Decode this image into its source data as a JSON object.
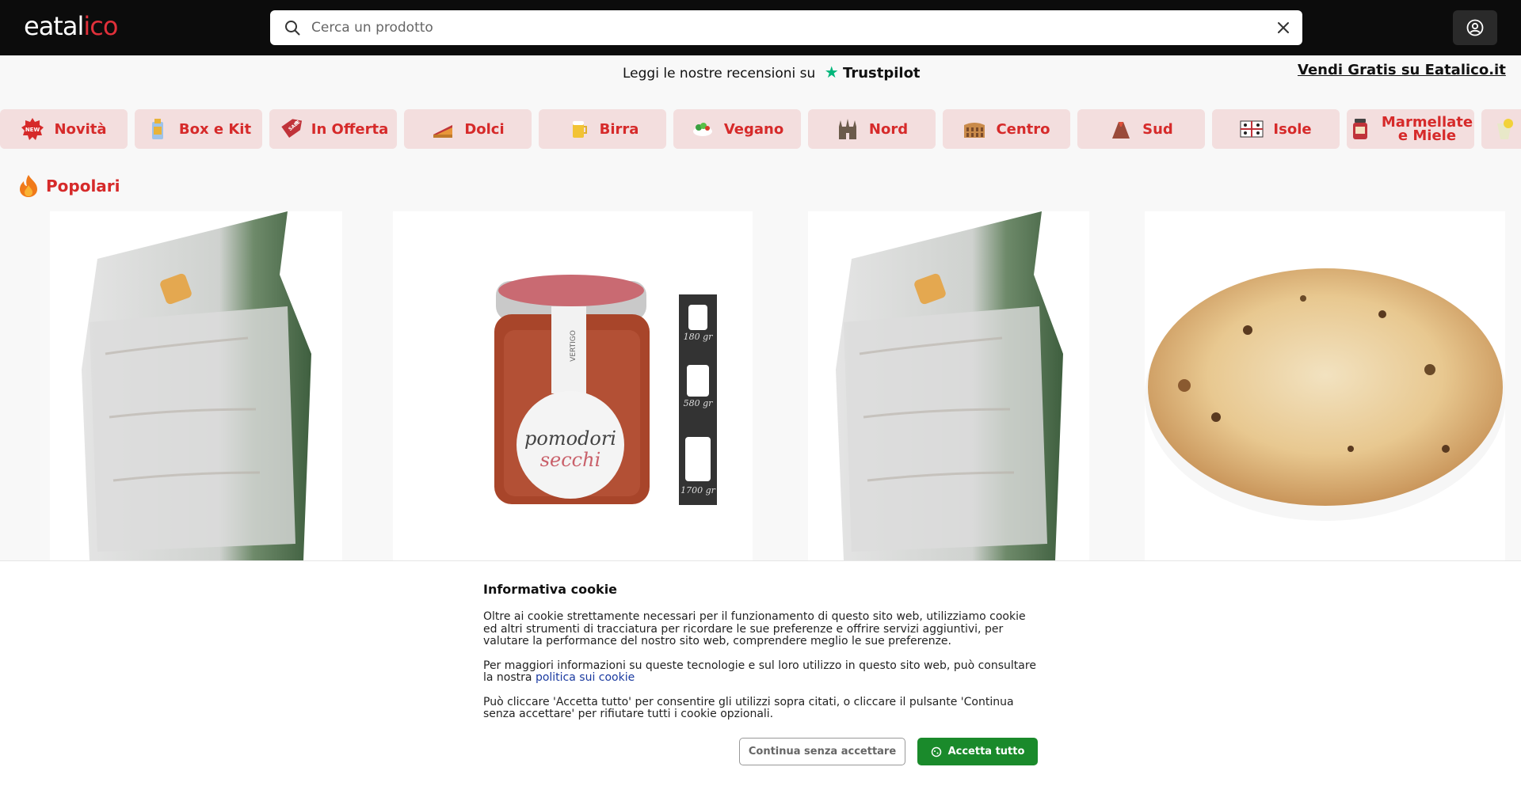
{
  "header": {
    "logo_left": "eatal",
    "logo_mid": "i",
    "logo_right": "co",
    "search_placeholder": "Cerca un prodotto"
  },
  "review": {
    "text": "Leggi le nostre recensioni su",
    "star": "★",
    "brand": "Trustpilot",
    "sell_link": "Vendi Gratis su Eatalico.it"
  },
  "categories": [
    {
      "label": "Novità",
      "icon": "new-badge-icon"
    },
    {
      "label": "Box e Kit",
      "icon": "box-icon"
    },
    {
      "label": "In Offerta",
      "icon": "sale-tag-icon"
    },
    {
      "label": "Dolci",
      "icon": "cake-icon"
    },
    {
      "label": "Birra",
      "icon": "beer-icon"
    },
    {
      "label": "Vegano",
      "icon": "salad-icon"
    },
    {
      "label": "Nord",
      "icon": "cathedral-icon"
    },
    {
      "label": "Centro",
      "icon": "colosseum-icon"
    },
    {
      "label": "Sud",
      "icon": "volcano-icon"
    },
    {
      "label": "Isole",
      "icon": "sardinia-flag-icon"
    },
    {
      "label_line1": "Marmellate",
      "label_line2": "e Miele",
      "icon": "jam-jar-icon"
    }
  ],
  "section": {
    "title": "Popolari"
  },
  "products": [
    {
      "image": "mushroom-grow-bag"
    },
    {
      "image": "sun-dried-tomato-jar",
      "jar_line1": "pomodori",
      "jar_line2": "secchi",
      "brand": "VERTIGO",
      "sizes": [
        "180 gr",
        "580 gr",
        "1700 gr"
      ]
    },
    {
      "image": "mushroom-grow-bag"
    },
    {
      "image": "pizza-bread"
    }
  ],
  "cookie": {
    "title": "Informativa cookie",
    "p1": "Oltre ai cookie strettamente necessari per il funzionamento di questo sito web, utilizziamo cookie ed altri strumenti di tracciatura per ricordare le sue preferenze e offrire servizi aggiuntivi, per valutare la performance del nostro sito web, comprendere meglio le sue preferenze.",
    "p2_text": "Per maggiori informazioni su queste tecnologie e sul loro utilizzo in questo sito web, può consultare la nostra",
    "p2_link": "politica sui cookie",
    "p3": "Può cliccare 'Accetta tutto' per consentire gli utilizzi sopra citati, o cliccare il pulsante 'Continua senza accettare' per rifiutare tutti i cookie opzionali.",
    "btn_continue": "Continua senza accettare",
    "btn_accept": "Accetta tutto"
  },
  "colors": {
    "brand_red": "#d62a2a",
    "category_bg": "#f3dede",
    "accept_green": "#1a8a2b",
    "trustpilot_green": "#00b67a"
  }
}
